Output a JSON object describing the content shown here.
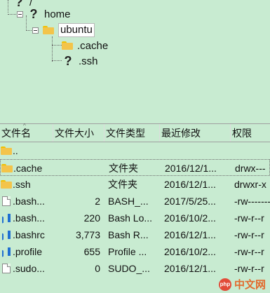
{
  "tree": {
    "root_label": "/",
    "home_label": "home",
    "ubuntu_label": "ubuntu",
    "cache_label": ".cache",
    "ssh_label": ".ssh"
  },
  "headers": {
    "name": "文件名",
    "size": "文件大小",
    "type": "文件类型",
    "modified": "最近修改",
    "permissions": "权限"
  },
  "rows": [
    {
      "icon": "folder-icon",
      "name": "..",
      "size": "",
      "type": "",
      "date": "",
      "perm": ""
    },
    {
      "icon": "folder-icon",
      "name": ".cache",
      "size": "",
      "type": "文件夹",
      "date": "2016/12/1...",
      "perm": "drwx---"
    },
    {
      "icon": "folder-icon",
      "name": ".ssh",
      "size": "",
      "type": "文件夹",
      "date": "2016/12/1...",
      "perm": "drwxr-x"
    },
    {
      "icon": "file-icon",
      "name": ".bash...",
      "size": "2",
      "type": "BASH_...",
      "date": "2017/5/25...",
      "perm": "-rw-------"
    },
    {
      "icon": "vs-file-icon",
      "name": ".bash...",
      "size": "220",
      "type": "Bash Lo...",
      "date": "2016/10/2...",
      "perm": "-rw-r--r"
    },
    {
      "icon": "vs-file-icon",
      "name": ".bashrc",
      "size": "3,773",
      "type": "Bash R...",
      "date": "2016/12/1...",
      "perm": "-rw-r--r"
    },
    {
      "icon": "vs-file-icon",
      "name": ".profile",
      "size": "655",
      "type": "Profile ...",
      "date": "2016/10/2...",
      "perm": "-rw-r--r"
    },
    {
      "icon": "file-icon",
      "name": ".sudo...",
      "size": "0",
      "type": "SUDO_...",
      "date": "2016/12/1...",
      "perm": "-rw-r--r"
    }
  ],
  "watermark": {
    "badge": "php",
    "text": "中文网"
  }
}
